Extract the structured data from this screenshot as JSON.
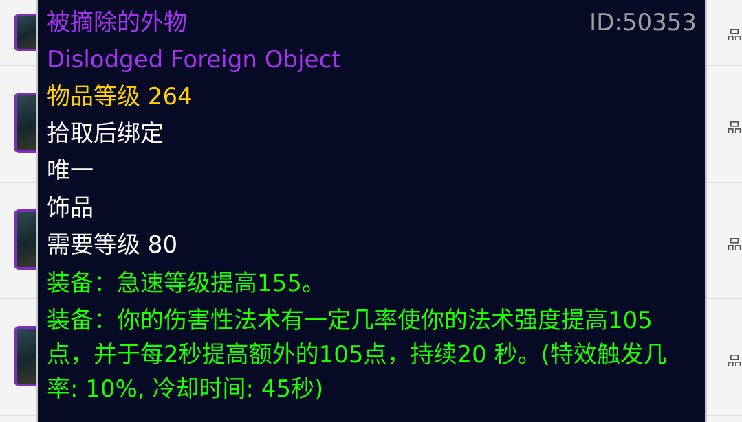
{
  "tooltip": {
    "name_cn": "被摘除的外物",
    "item_id": "ID:50353",
    "name_en": "Dislodged Foreign Object",
    "item_level": "物品等级 264",
    "bind": "拾取后绑定",
    "unique": "唯一",
    "slot": "饰品",
    "required_level": "需要等级 80",
    "equip_1": "装备：急速等级提高155。",
    "equip_2": "装备：你的伤害性法术有一定几率使你的法术强度提高105点，并于每2秒提高额外的105点，持续20 秒。(特效触发几率: 10%, 冷却时间: 45秒)"
  },
  "background": {
    "row_glyph": "品"
  },
  "colors": {
    "tooltip_bg": "#070a25",
    "epic_purple": "#a335ee",
    "item_level_gold": "#ffd100",
    "id_gray": "#9d9d9d",
    "equip_green": "#1eff00",
    "text_white": "#ffffff"
  }
}
